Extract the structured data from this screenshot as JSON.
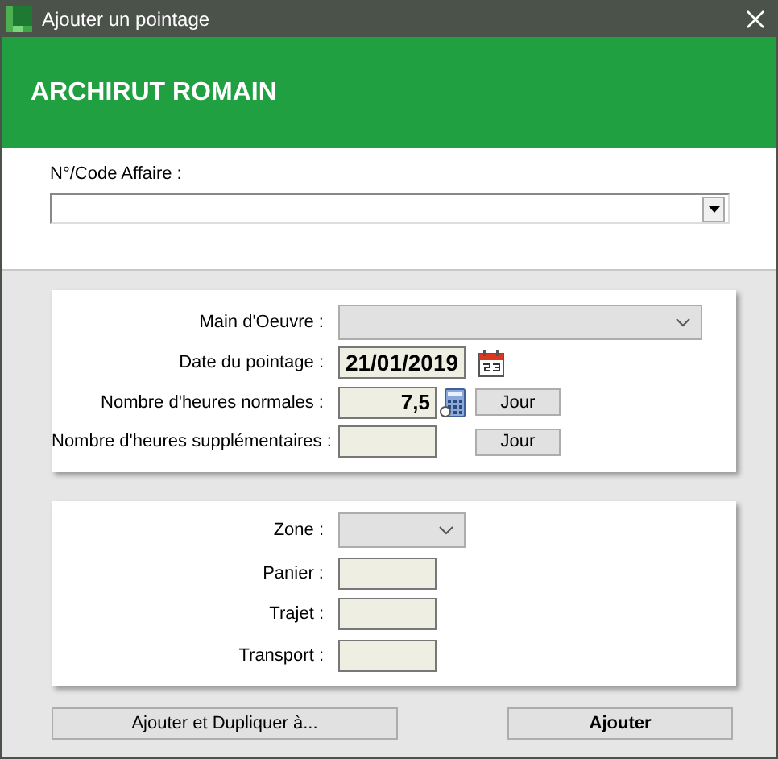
{
  "window": {
    "title": "Ajouter un pointage"
  },
  "header": {
    "name": "ARCHIRUT ROMAIN"
  },
  "affaire": {
    "label": "N°/Code Affaire :"
  },
  "panels": [
    {
      "rows": [
        {
          "label": "Main d'Oeuvre :",
          "kind": "combo",
          "wide": true
        },
        {
          "label": "Date du pointage :",
          "kind": "date",
          "value": "21/01/2019"
        },
        {
          "label": "Nombre d'heures normales :",
          "kind": "number",
          "value": "7,5",
          "calculator": true,
          "button": "Jour"
        },
        {
          "label": "Nombre d'heures supplémentaires :",
          "kind": "number",
          "calculator": false,
          "button": "Jour"
        }
      ]
    },
    {
      "rows": [
        {
          "label": "Zone :",
          "kind": "combo",
          "wide": false
        },
        {
          "label": "Panier :",
          "kind": "number",
          "calculator": false
        },
        {
          "label": "Trajet :",
          "kind": "number",
          "calculator": false
        },
        {
          "label": "Transport :",
          "kind": "number",
          "calculator": false
        }
      ]
    }
  ],
  "buttons": [
    {
      "label": "Ajouter et Dupliquer à...",
      "primary": false
    },
    {
      "label": "Ajouter",
      "primary": true
    }
  ]
}
